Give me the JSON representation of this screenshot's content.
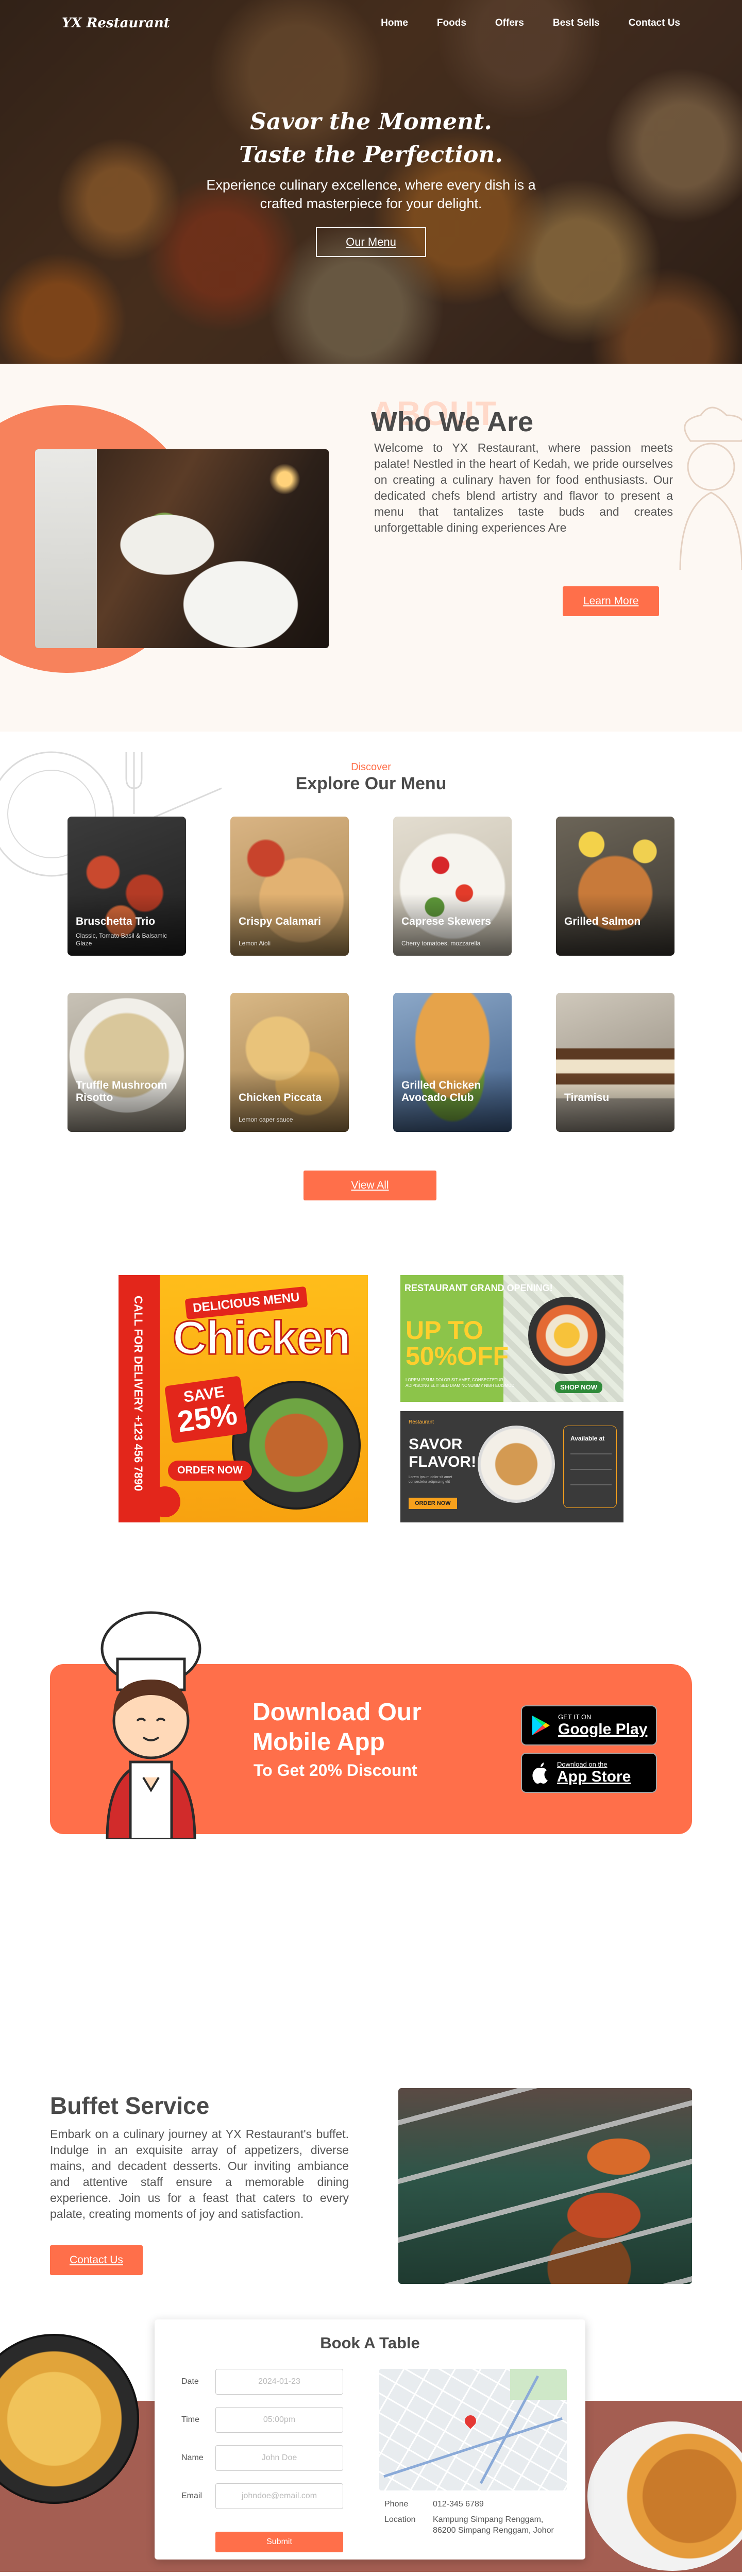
{
  "nav": {
    "logo": "YX Restaurant",
    "links": [
      "Home",
      "Foods",
      "Offers",
      "Best Sells",
      "Contact Us"
    ]
  },
  "hero": {
    "title_line1": "Savor the Moment.",
    "title_line2": "Taste the Perfection.",
    "subtitle_line1": "Experience culinary excellence, where every dish is a",
    "subtitle_line2": "crafted masterpiece for your delight.",
    "button": "Our Menu"
  },
  "about": {
    "ghost": "ABOUT",
    "title": "Who We Are",
    "text": "Welcome to YX Restaurant, where passion meets palate! Nestled in the heart of Kedah, we pride ourselves on creating a culinary haven for food enthusiasts. Our dedicated chefs blend artistry and flavor to present a menu that tantalizes taste buds and creates unforgettable dining experiences Are",
    "button": "Learn More"
  },
  "menu": {
    "kicker": "Discover",
    "title": "Explore Our Menu",
    "items": [
      {
        "name": "Bruschetta Trio",
        "desc": "Classic, Tomato Basil & Balsamic Glaze"
      },
      {
        "name": "Crispy Calamari",
        "desc": "Lemon Aioli"
      },
      {
        "name": "Caprese Skewers",
        "desc": "Cherry tomatoes, mozzarella"
      },
      {
        "name": "Grilled Salmon",
        "desc": ""
      },
      {
        "name": "Truffle Mushroom Risotto",
        "desc": ""
      },
      {
        "name": "Chicken Piccata",
        "desc": "Lemon caper sauce"
      },
      {
        "name": "Grilled Chicken Avocado Club",
        "desc": ""
      },
      {
        "name": "Tiramisu",
        "desc": ""
      }
    ],
    "button": "View All"
  },
  "promos": {
    "chicken": {
      "vertical": "CALL FOR DELIVERY +123 456 7890",
      "delicious": "DELICIOUS MENU",
      "headline": "Chicken",
      "save_label": "SAVE",
      "save_value": "25%",
      "order": "ORDER NOW"
    },
    "grand": {
      "title": "RESTAURANT GRAND OPENING!",
      "big_line1": "UP TO",
      "big_line2": "50%OFF",
      "small": "LOREM IPSUM DOLOR SIT AMET, CONSECTETUR ADIPISCING ELIT SED DIAM NONUMMY NIBH EUISMOD",
      "shop": "SHOP NOW"
    },
    "savor": {
      "brand": "Restaurant",
      "title_line1": "SAVOR",
      "title_line2": "FLAVOR!",
      "small": "Lorem ipsum dolor sit amet consectetur adipiscing elit",
      "button": "ORDER NOW",
      "available": "Available at"
    }
  },
  "app": {
    "title_line1": "Download Our",
    "title_line2": "Mobile App",
    "subtitle": "To Get 20% Discount",
    "google_small": "GET IT ON",
    "google_big": "Google Play",
    "apple_small": "Download on the",
    "apple_big": "App Store"
  },
  "buffet": {
    "title": "Buffet Service",
    "text": "Embark on a culinary journey at YX Restaurant's buffet. Indulge in an exquisite array of appetizers, diverse mains, and decadent desserts. Our inviting ambiance and attentive staff ensure a memorable dining experience. Join us for a feast that caters to every palate, creating moments of joy and satisfaction.",
    "button": "Contact Us"
  },
  "booking": {
    "title": "Book A Table",
    "date_label": "Date",
    "date_value": "2024-01-23",
    "time_label": "Time",
    "time_value": "05:00pm",
    "name_label": "Name",
    "name_placeholder": "John Doe",
    "email_label": "Email",
    "email_placeholder": "johndoe@email.com",
    "submit": "Submit",
    "phone_label": "Phone",
    "phone_value": "012-345 6789",
    "location_label": "Location",
    "location_line1": "Kampung Simpang Renggam,",
    "location_line2": "86200 Simpang Renggam, Johor"
  },
  "colors": {
    "accent": "#ff6f4a",
    "about_bg": "#fdf8f3",
    "booking_floor": "#a45e52"
  }
}
